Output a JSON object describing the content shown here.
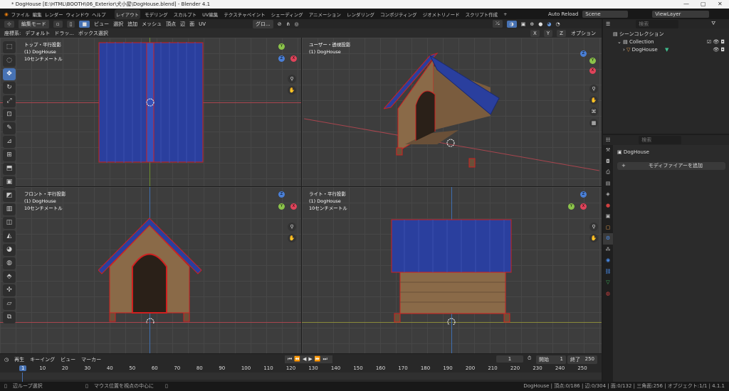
{
  "window": {
    "title": "* DogHouse [E:\\HTML\\BOOTH\\06_Exterior\\犬小屋\\DogHouse.blend] - Blender 4.1",
    "minimize": "—",
    "maximize": "▢",
    "close": "✕"
  },
  "menu": [
    "ファイル",
    "編集",
    "レンダー",
    "ウィンドウ",
    "ヘルプ"
  ],
  "workspaces": [
    "レイアウト",
    "モデリング",
    "スカルプト",
    "UV編集",
    "テクスチャペイント",
    "シェーディング",
    "アニメーション",
    "レンダリング",
    "コンポジティング",
    "ジオメトリノード",
    "スクリプト作成",
    "+"
  ],
  "top_right": {
    "auto_reload": "Auto Reload",
    "scene": "Scene",
    "view_layer": "ViewLayer"
  },
  "viewport_header": {
    "mode": "編集モード",
    "menus": [
      "ビュー",
      "選択",
      "追加",
      "メッシュ",
      "頂点",
      "辺",
      "面",
      "UV"
    ],
    "transform": "グロ...",
    "options": "オプション",
    "axes": [
      "X",
      "Y",
      "Z"
    ]
  },
  "tool_header": {
    "coord_label": "座標系:",
    "coord_value": "デフォルト",
    "drag": "ドラッ...",
    "select": "ボックス選択"
  },
  "viewports": [
    {
      "name": "トップ・平行投影",
      "object": "(1) DogHouse",
      "scale": "10センチメートル",
      "gizmo": [
        "Y",
        "Z",
        "X"
      ]
    },
    {
      "name": "ユーザー・透視投影",
      "object": "(1) DogHouse",
      "scale": "",
      "gizmo": [
        "Z",
        "Y",
        "X"
      ]
    },
    {
      "name": "フロント・平行投影",
      "object": "(1) DogHouse",
      "scale": "10センチメートル",
      "gizmo": [
        "Z",
        "Y",
        "X"
      ]
    },
    {
      "name": "ライト・平行投影",
      "object": "(1) DogHouse",
      "scale": "10センチメートル",
      "gizmo": [
        "Z",
        "X",
        "Y"
      ]
    }
  ],
  "outliner": {
    "search": "検索",
    "scene_collection": "シーンコレクション",
    "collection": "Collection",
    "object": "DogHouse"
  },
  "properties": {
    "search": "検索",
    "object": "DogHouse",
    "add_modifier": "モディファイアーを追加"
  },
  "timeline": {
    "menus": [
      "再生",
      "キーイング",
      "ビュー",
      "マーカー"
    ],
    "current_frame": "1",
    "start_label": "開始",
    "start": "1",
    "end_label": "終了",
    "end": "250",
    "ticks": [
      "1",
      "10",
      "20",
      "30",
      "40",
      "50",
      "60",
      "70",
      "80",
      "90",
      "100",
      "110",
      "120",
      "130",
      "140",
      "150",
      "160",
      "170",
      "180",
      "190",
      "200",
      "210",
      "220",
      "230",
      "240",
      "250"
    ]
  },
  "status": {
    "left": "辺ループ選択",
    "middle": "マウス位置を視点の中心に",
    "right": "DogHouse | 頂点:0/186 | 辺:0/304 | 面:0/132 | 三角面:256 | オブジェクト:1/1 | 4.1.1"
  },
  "colors": {
    "accent": "#4772b3",
    "roof": "#2a3f9e",
    "wood": "#8a6a48",
    "edge": "#d02020"
  }
}
